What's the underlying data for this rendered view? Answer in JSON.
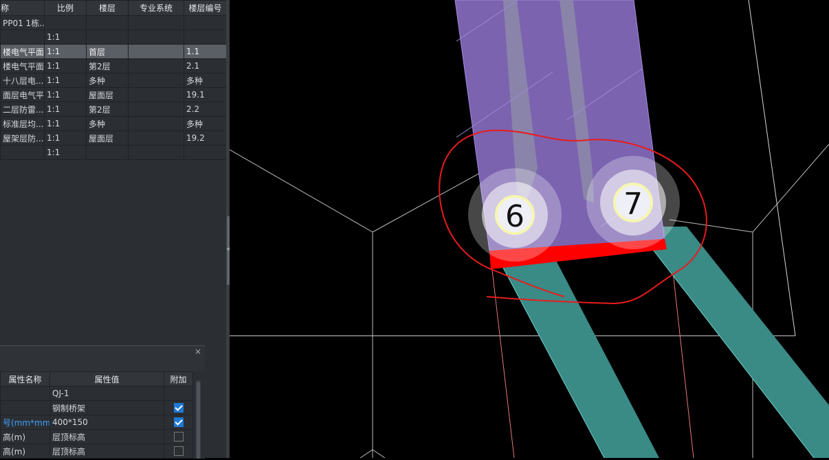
{
  "drawing_list": {
    "headers": [
      "称",
      "比例",
      "楼层",
      "专业系统",
      "楼层编号"
    ],
    "rows": [
      {
        "name": "PP01 1栋...",
        "scale": "",
        "floor": "",
        "system": "",
        "floor_no": ""
      },
      {
        "name": "",
        "scale": "1:1",
        "floor": "",
        "system": "",
        "floor_no": ""
      },
      {
        "name": "楼电气平面...",
        "scale": "1:1",
        "floor": "首层",
        "system": "",
        "floor_no": "1.1",
        "selected": true
      },
      {
        "name": "楼电气平面...",
        "scale": "1:1",
        "floor": "第2层",
        "system": "",
        "floor_no": "2.1"
      },
      {
        "name": "十八层电...",
        "scale": "1:1",
        "floor": "多种",
        "system": "",
        "floor_no": "多种"
      },
      {
        "name": "面层电气平...",
        "scale": "1:1",
        "floor": "屋面层",
        "system": "",
        "floor_no": "19.1"
      },
      {
        "name": "二层防雷...",
        "scale": "1:1",
        "floor": "第2层",
        "system": "",
        "floor_no": "2.2"
      },
      {
        "name": "标准层均...",
        "scale": "1:1",
        "floor": "多种",
        "system": "",
        "floor_no": "多种"
      },
      {
        "name": "屋架层防...",
        "scale": "1:1",
        "floor": "屋面层",
        "system": "",
        "floor_no": "19.2"
      },
      {
        "name": "",
        "scale": "1:1",
        "floor": "",
        "system": "",
        "floor_no": ""
      }
    ]
  },
  "properties": {
    "close_label": "×",
    "headers": [
      "属性名称",
      "属性值",
      "附加"
    ],
    "rows": [
      {
        "name": "",
        "value": "QJ-1",
        "checkbox": "none"
      },
      {
        "name": "",
        "value": "钢制桥架",
        "checkbox": "on"
      },
      {
        "name": "号(mm*mm)",
        "value": "400*150",
        "checkbox": "on",
        "highlight": true
      },
      {
        "name": "高(m)",
        "value": "层顶标高",
        "checkbox": "off"
      },
      {
        "name": "高(m)",
        "value": "层顶标高",
        "checkbox": "off"
      }
    ]
  },
  "canvas": {
    "markers": [
      {
        "label": "6"
      },
      {
        "label": "7"
      }
    ],
    "colors": {
      "background": "#000000",
      "tray_fill": "#7b63b0",
      "pipe_fill": "#3a8a86",
      "highlight_bar": "#ff0000",
      "annotation": "#e81c1c",
      "axis_line": "#d9d9d9",
      "marker_ring": "#f6f6b0"
    }
  }
}
